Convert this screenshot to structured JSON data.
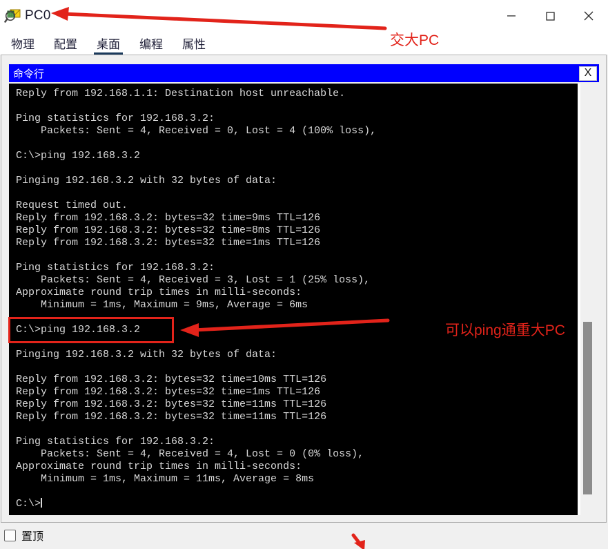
{
  "window": {
    "title": "PC0",
    "icon": "inspect-device-icon",
    "controls": {
      "minimize": "minimize-icon",
      "maximize": "maximize-icon",
      "close": "close-icon"
    }
  },
  "tabs": [
    {
      "label": "物理",
      "active": false
    },
    {
      "label": "配置",
      "active": false
    },
    {
      "label": "桌面",
      "active": true
    },
    {
      "label": "编程",
      "active": false
    },
    {
      "label": "属性",
      "active": false
    }
  ],
  "cmd_window": {
    "title": "命令行",
    "close_label": "X",
    "terminal_lines": [
      "Reply from 192.168.1.1: Destination host unreachable.",
      "",
      "Ping statistics for 192.168.3.2:",
      "    Packets: Sent = 4, Received = 0, Lost = 4 (100% loss),",
      "",
      "C:\\>ping 192.168.3.2",
      "",
      "Pinging 192.168.3.2 with 32 bytes of data:",
      "",
      "Request timed out.",
      "Reply from 192.168.3.2: bytes=32 time=9ms TTL=126",
      "Reply from 192.168.3.2: bytes=32 time=8ms TTL=126",
      "Reply from 192.168.3.2: bytes=32 time=1ms TTL=126",
      "",
      "Ping statistics for 192.168.3.2:",
      "    Packets: Sent = 4, Received = 3, Lost = 1 (25% loss),",
      "Approximate round trip times in milli-seconds:",
      "    Minimum = 1ms, Maximum = 9ms, Average = 6ms",
      "",
      "C:\\>ping 192.168.3.2",
      "",
      "Pinging 192.168.3.2 with 32 bytes of data:",
      "",
      "Reply from 192.168.3.2: bytes=32 time=10ms TTL=126",
      "Reply from 192.168.3.2: bytes=32 time=1ms TTL=126",
      "Reply from 192.168.3.2: bytes=32 time=11ms TTL=126",
      "Reply from 192.168.3.2: bytes=32 time=11ms TTL=126",
      "",
      "Ping statistics for 192.168.3.2:",
      "    Packets: Sent = 4, Received = 4, Lost = 0 (0% loss),",
      "Approximate round trip times in milli-seconds:",
      "    Minimum = 1ms, Maximum = 11ms, Average = 8ms",
      "",
      "C:\\>"
    ]
  },
  "bottom": {
    "topmost_label": "置顶",
    "topmost_checked": false
  },
  "annotations": {
    "accent_color": "#e2231a",
    "label_1": "交大PC",
    "label_2": "可以ping通重大PC"
  }
}
